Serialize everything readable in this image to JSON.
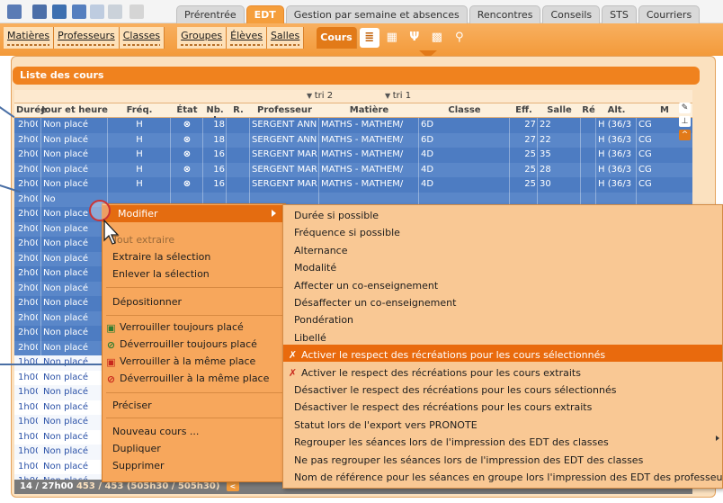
{
  "top_tabs": [
    "Prérentrée",
    "EDT",
    "Gestion par semaine et absences",
    "Rencontres",
    "Conseils",
    "STS",
    "Courriers"
  ],
  "active_top_tab": "EDT",
  "sub_tabs": [
    "Matières",
    "Professeurs",
    "Classes",
    "Groupes",
    "Élèves",
    "Salles",
    "Cours"
  ],
  "active_sub_tab": "Cours",
  "panel_title": "Liste des cours",
  "sort_labels": {
    "tri2": "tri 2",
    "tri1": "tri 1"
  },
  "columns": [
    "Durée",
    "Jour et heure",
    "Fréq.",
    "État",
    "Nb. I",
    "R.",
    "Professeur",
    "Matière",
    "Classe",
    "Eff.",
    "Salle",
    "Ré",
    "Alt.",
    "M"
  ],
  "rows": [
    {
      "duree": "2h00",
      "jour": "Non placé",
      "freq": "H",
      "nb": "18",
      "prof": "SERGENT ANNIE",
      "mat": "MATHS - MATHEM/",
      "classe": "6D",
      "eff": "27",
      "salle": "22",
      "alt": "H (36/3",
      "m": "CG",
      "selected": true
    },
    {
      "duree": "2h00",
      "jour": "Non placé",
      "freq": "H",
      "nb": "18",
      "prof": "SERGENT ANNIE",
      "mat": "MATHS - MATHEM/",
      "classe": "6D",
      "eff": "27",
      "salle": "22",
      "alt": "H (36/3",
      "m": "CG",
      "selected": true
    },
    {
      "duree": "2h00",
      "jour": "Non placé",
      "freq": "H",
      "nb": "16",
      "prof": "SERGENT MARC",
      "mat": "MATHS - MATHEM/",
      "classe": "4D",
      "eff": "25",
      "salle": "35",
      "alt": "H (36/3",
      "m": "CG",
      "selected": true
    },
    {
      "duree": "2h00",
      "jour": "Non placé",
      "freq": "H",
      "nb": "16",
      "prof": "SERGENT MARC",
      "mat": "MATHS - MATHEM/",
      "classe": "4D",
      "eff": "25",
      "salle": "28",
      "alt": "H (36/3",
      "m": "CG",
      "selected": true
    },
    {
      "duree": "2h00",
      "jour": "Non placé",
      "freq": "H",
      "nb": "16",
      "prof": "SERGENT MARC",
      "mat": "MATHS - MATHEM/",
      "classe": "4D",
      "eff": "25",
      "salle": "30",
      "alt": "H (36/3",
      "m": "CG",
      "selected": true
    },
    {
      "duree": "2h00",
      "jour": "No",
      "selected": true
    },
    {
      "duree": "2h00",
      "jour": "Non place",
      "selected": true
    },
    {
      "duree": "2h00",
      "jour": "Non place",
      "selected": true
    },
    {
      "duree": "2h00",
      "jour": "Non placé",
      "selected": true
    },
    {
      "duree": "2h00",
      "jour": "Non placé",
      "selected": true
    },
    {
      "duree": "2h00",
      "jour": "Non placé",
      "selected": true
    },
    {
      "duree": "2h00",
      "jour": "Non placé",
      "selected": true
    },
    {
      "duree": "2h00",
      "jour": "Non placé",
      "selected": true
    },
    {
      "duree": "2h00",
      "jour": "Non placé",
      "selected": true
    },
    {
      "duree": "2h00",
      "jour": "Non placé",
      "selected": true
    },
    {
      "duree": "2h00",
      "jour": "Non placé",
      "selected": true
    },
    {
      "duree": "1h00",
      "jour": "Non placé",
      "selected": false
    },
    {
      "duree": "1h00",
      "jour": "Non placé",
      "selected": false
    },
    {
      "duree": "1h00",
      "jour": "Non placé",
      "selected": false
    },
    {
      "duree": "1h00",
      "jour": "Non placé",
      "selected": false
    },
    {
      "duree": "1h00",
      "jour": "Non placé",
      "selected": false
    },
    {
      "duree": "1h00",
      "jour": "Non placé",
      "selected": false
    },
    {
      "duree": "1h00",
      "jour": "Non placé",
      "selected": false
    },
    {
      "duree": "1h00",
      "jour": "Non placé",
      "selected": false
    },
    {
      "duree": "1h00",
      "jour": "Non placé",
      "selected": false
    }
  ],
  "status": {
    "left": "14 / 27h00",
    "right": "453 / 453  (505h30 / 505h30)"
  },
  "context_menu": {
    "modifier": "Modifier",
    "tout_extraire": "Tout extraire",
    "extraire": "Extraire la sélection",
    "enlever": "Enlever la sélection",
    "depositionner": "Dépositionner",
    "verrouiller_tj": "Verrouiller toujours placé",
    "deverrouiller_tj": "Déverrouiller toujours placé",
    "verrouiller_mp": "Verrouiller à la même place",
    "deverrouiller_mp": "Déverrouiller à la même place",
    "preciser": "Préciser",
    "nouveau": "Nouveau cours ...",
    "dupliquer": "Dupliquer",
    "supprimer": "Supprimer"
  },
  "submenu": [
    "Durée si possible",
    "Fréquence si possible",
    "Alternance",
    "Modalité",
    "Affecter un co-enseignement",
    "Désaffecter un co-enseignement",
    "Pondération",
    "Libellé",
    "Activer le respect des récréations pour les cours sélectionnés",
    "Activer le respect des récréations pour les cours extraits",
    "Désactiver le respect des récréations pour les cours sélectionnés",
    "Désactiver le respect des récréations pour les cours extraits",
    "Statut lors de l'export vers PRONOTE",
    "Regrouper les séances lors de l'impression des EDT des classes",
    "Ne pas regrouper les séances lors de l'impression des EDT des classes",
    "Nom de référence pour les séances en groupe lors l'impression des EDT des professeurs"
  ],
  "submenu_highlight_index": 8,
  "colors": {
    "accent": "#f39a3a",
    "selection": "#4f7fc4",
    "menu": "#f7a75c",
    "highlight": "#e96a0d"
  }
}
